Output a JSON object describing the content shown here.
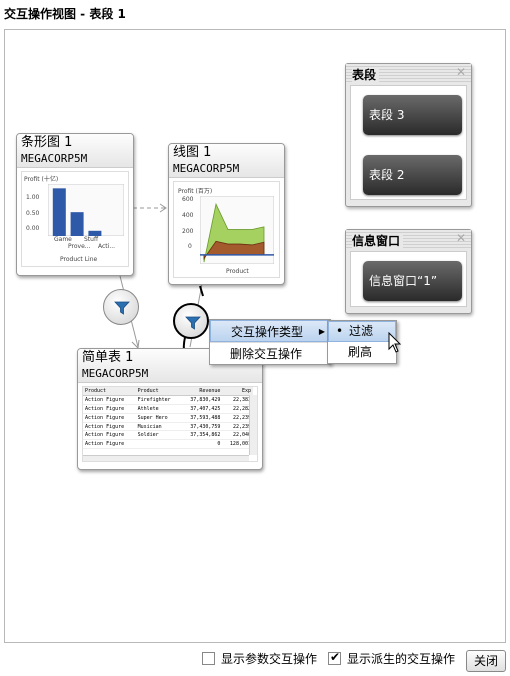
{
  "window": {
    "title": "交互操作视图 - 表段 1"
  },
  "bar_card": {
    "title": "条形图 1",
    "subtitle": "MEGACORP5M",
    "chart_title": "Profit (十亿)",
    "yticks": [
      "1.00",
      "0.50",
      "0.00"
    ],
    "xticks": [
      "Game",
      "Stuff",
      "Prove...",
      "Acti..."
    ],
    "xlabel": "Product Line"
  },
  "line_card": {
    "title": "线图 1",
    "subtitle": "MEGACORP5M",
    "chart_title": "Profit (百万)",
    "yticks": [
      "600",
      "400",
      "200",
      "0"
    ],
    "xlabel": "Product"
  },
  "table_card": {
    "title": "简单表 1",
    "subtitle": "MEGACORP5M",
    "headers": [
      "Product",
      "Product",
      "Revenue",
      "Exp"
    ],
    "rows": [
      [
        "Action Figure",
        "Firefighter",
        "37,830,429",
        "22,383"
      ],
      [
        "Action Figure",
        "Athlete",
        "37,407,425",
        "22,282"
      ],
      [
        "Action Figure",
        "Super Hero",
        "37,593,488",
        "22,239"
      ],
      [
        "Action Figure",
        "Musician",
        "37,430,759",
        "22,239"
      ],
      [
        "Action Figure",
        "Soldier",
        "37,354,862",
        "22,040"
      ],
      [
        "Action Figure",
        "",
        "0",
        "128,001"
      ]
    ]
  },
  "segment_panel": {
    "title": "表段",
    "buttons": [
      "表段 3",
      "表段 2"
    ]
  },
  "info_panel": {
    "title": "信息窗口",
    "buttons": [
      "信息窗口“1”"
    ]
  },
  "context_menu": {
    "items": [
      "交互操作类型",
      "删除交互操作"
    ],
    "submenu": [
      "过滤",
      "刷高"
    ]
  },
  "footer": {
    "show_param_label": "显示参数交互操作",
    "show_param_checked": false,
    "show_derived_label": "显示派生的交互操作",
    "show_derived_checked": true,
    "close_label": "关闭"
  },
  "chart_data": [
    {
      "type": "bar",
      "title": "Profit (十亿)",
      "xlabel": "Product Line",
      "categories": [
        "Game",
        "Stuff",
        "Prove...",
        "Acti..."
      ],
      "values": [
        1.1,
        0.55,
        0.12,
        0
      ],
      "ylim": [
        0,
        1.2
      ]
    },
    {
      "type": "area",
      "title": "Profit (百万)",
      "xlabel": "Product",
      "ylim": [
        -100,
        650
      ],
      "series": [
        {
          "values": [
            -80,
            560,
            280,
            280,
            280,
            310
          ]
        },
        {
          "values": [
            -40,
            150,
            120,
            120,
            110,
            140
          ]
        }
      ]
    }
  ]
}
